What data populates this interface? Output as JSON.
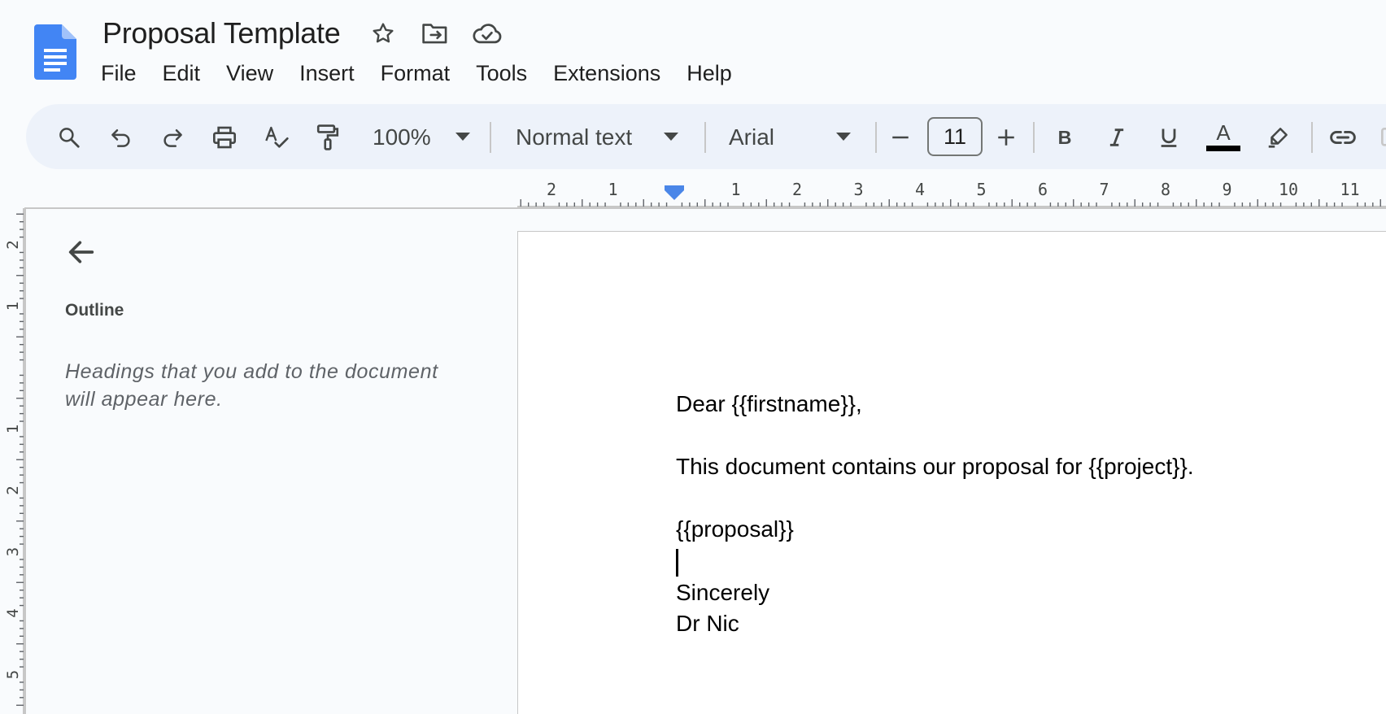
{
  "document": {
    "title": "Proposal Template"
  },
  "menubar": {
    "items": [
      "File",
      "Edit",
      "View",
      "Insert",
      "Format",
      "Tools",
      "Extensions",
      "Help"
    ]
  },
  "toolbar": {
    "zoom": "100%",
    "paragraph_style": "Normal text",
    "font": "Arial",
    "font_size": "11",
    "text_color": "#000000"
  },
  "ruler": {
    "horizontal_labels": [
      "2",
      "1",
      "1",
      "2",
      "3",
      "4",
      "5",
      "6",
      "7",
      "8",
      "9",
      "10",
      "11"
    ],
    "vertical_labels": [
      "2",
      "1",
      "1",
      "2",
      "3",
      "4",
      "5"
    ]
  },
  "outline": {
    "title": "Outline",
    "hint": "Headings that you add to the document will appear here."
  },
  "content": {
    "lines": [
      "Dear {{firstname}},",
      "",
      "This document contains our proposal for {{project}}.",
      "",
      "{{proposal}}",
      "",
      "Sincerely",
      "Dr Nic"
    ]
  },
  "colors": {
    "docs_blue": "#4285f4",
    "toolbar_bg": "#edf2fa",
    "ruler_marker": "#4a86e8"
  }
}
